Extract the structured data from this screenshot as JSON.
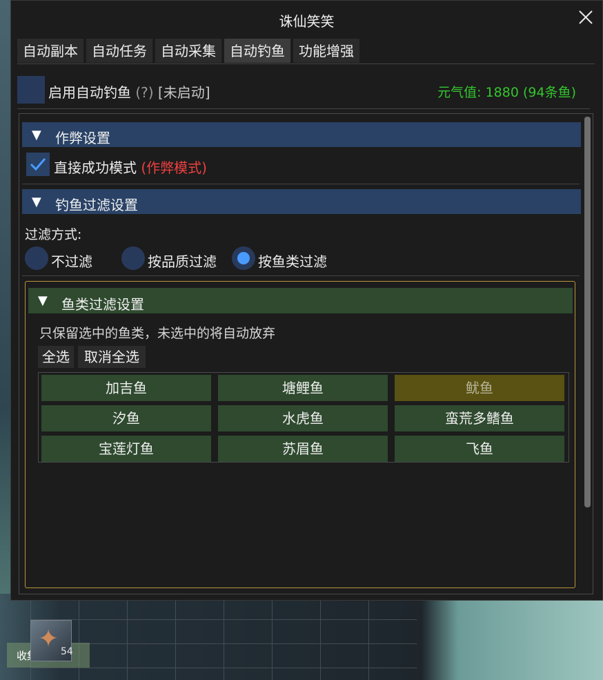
{
  "window": {
    "title": "诛仙笑笑"
  },
  "tabs": [
    {
      "label": "自动副本",
      "active": false
    },
    {
      "label": "自动任务",
      "active": false
    },
    {
      "label": "自动采集",
      "active": false
    },
    {
      "label": "自动钓鱼",
      "active": true
    },
    {
      "label": "功能增强",
      "active": false
    }
  ],
  "enable": {
    "label": "启用自动钓鱼",
    "help": "(?)",
    "status": "[未启动]"
  },
  "energy": {
    "text": "元气值: 1880 (94条鱼)"
  },
  "cheat_section": {
    "header": "作弊设置",
    "direct_success": {
      "label": "直接成功模式",
      "tag": "(作弊模式)",
      "checked": true
    }
  },
  "filter_section": {
    "header": "钓鱼过滤设置",
    "mode_label": "过滤方式:",
    "options": [
      {
        "label": "不过滤",
        "selected": false
      },
      {
        "label": "按品质过滤",
        "selected": false
      },
      {
        "label": "按鱼类过滤",
        "selected": true
      }
    ]
  },
  "fish_filter": {
    "header": "鱼类过滤设置",
    "description": "只保留选中的鱼类，未选中的将自动放弃",
    "select_all": "全选",
    "deselect_all": "取消全选",
    "fish": [
      {
        "name": "加吉鱼",
        "selected": false
      },
      {
        "name": "塘鲤鱼",
        "selected": false
      },
      {
        "name": "鱿鱼",
        "selected": true
      },
      {
        "name": "汐鱼",
        "selected": false
      },
      {
        "name": "水虎鱼",
        "selected": false
      },
      {
        "name": "蛮荒多鳍鱼",
        "selected": false
      },
      {
        "name": "宝莲灯鱼",
        "selected": false
      },
      {
        "name": "苏眉鱼",
        "selected": false
      },
      {
        "name": "飞鱼",
        "selected": false
      }
    ]
  },
  "background": {
    "inventory_count": "54",
    "collect_button": "收集"
  },
  "colors": {
    "accent_blue": "#294266",
    "green_header": "#2f4a2f",
    "selected_fish": "#5a5212",
    "energy_green": "#34c52e",
    "cheat_red": "#ee4040"
  }
}
